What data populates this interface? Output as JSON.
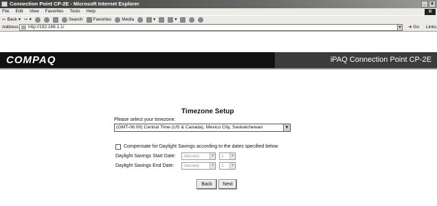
{
  "window": {
    "title": "Connection Point CP-2E - Microsoft Internet Explorer",
    "controls": [
      "_",
      "x"
    ]
  },
  "menu": [
    "File",
    "Edit",
    "View",
    "Favorites",
    "Tools",
    "Help"
  ],
  "toolbar": {
    "back_label": "Back",
    "search_label": "Search",
    "favorites_label": "Favorites",
    "media_label": "Media"
  },
  "address": {
    "label": "Address",
    "url": "http://192.168.1.1/",
    "go_label": "Go",
    "links_label": "Links"
  },
  "brand": {
    "logo": "COMPAQ",
    "product": "iPAQ Connection Point CP-2E"
  },
  "setup": {
    "title": "Timezone Setup",
    "tz_label": "Please select your timezone:",
    "tz_value": "(GMT-06:00) Central Time (US & Canada), Mexico City, Saskatchewan",
    "dst_label": "Compensate for Daylight Savings according to the dates specified below",
    "dst_checked": false,
    "start_label": "Daylight Savings Start Date:",
    "end_label": "Daylight Savings End Date:",
    "start_month": "January",
    "start_day": "1",
    "end_month": "January",
    "end_day": "1",
    "back_button": "Back",
    "next_button": "Next"
  }
}
